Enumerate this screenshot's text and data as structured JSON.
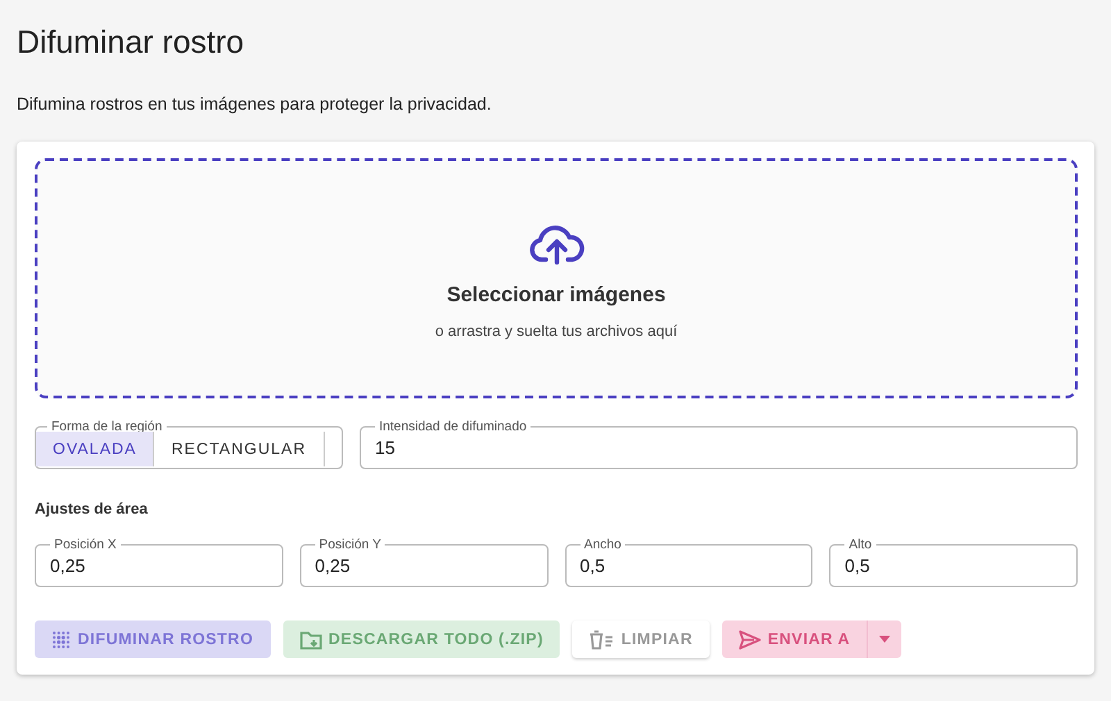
{
  "title": "Difuminar rostro",
  "subtitle": "Difumina rostros en tus imágenes para proteger la privacidad.",
  "dropzone": {
    "title": "Seleccionar imágenes",
    "hint": "o arrastra y suelta tus archivos aquí"
  },
  "region_shape": {
    "label": "Forma de la región",
    "options": [
      {
        "label": "OVALADA",
        "selected": true
      },
      {
        "label": "RECTANGULAR",
        "selected": false
      }
    ]
  },
  "intensity": {
    "label": "Intensidad de difuminado",
    "value": "15"
  },
  "area_settings": {
    "heading": "Ajustes de área",
    "fields": [
      {
        "label": "Posición X",
        "value": "0,25"
      },
      {
        "label": "Posición Y",
        "value": "0,25"
      },
      {
        "label": "Ancho",
        "value": "0,5"
      },
      {
        "label": "Alto",
        "value": "0,5"
      }
    ]
  },
  "buttons": [
    {
      "label": "DIFUMINAR ROSTRO",
      "kind": "blur",
      "disabled": true
    },
    {
      "label": "DESCARGAR TODO (.ZIP)",
      "kind": "download",
      "disabled": true
    },
    {
      "label": "LIMPIAR",
      "kind": "clear",
      "disabled": true
    },
    {
      "label": "ENVIAR A",
      "kind": "send",
      "disabled": true
    }
  ]
}
